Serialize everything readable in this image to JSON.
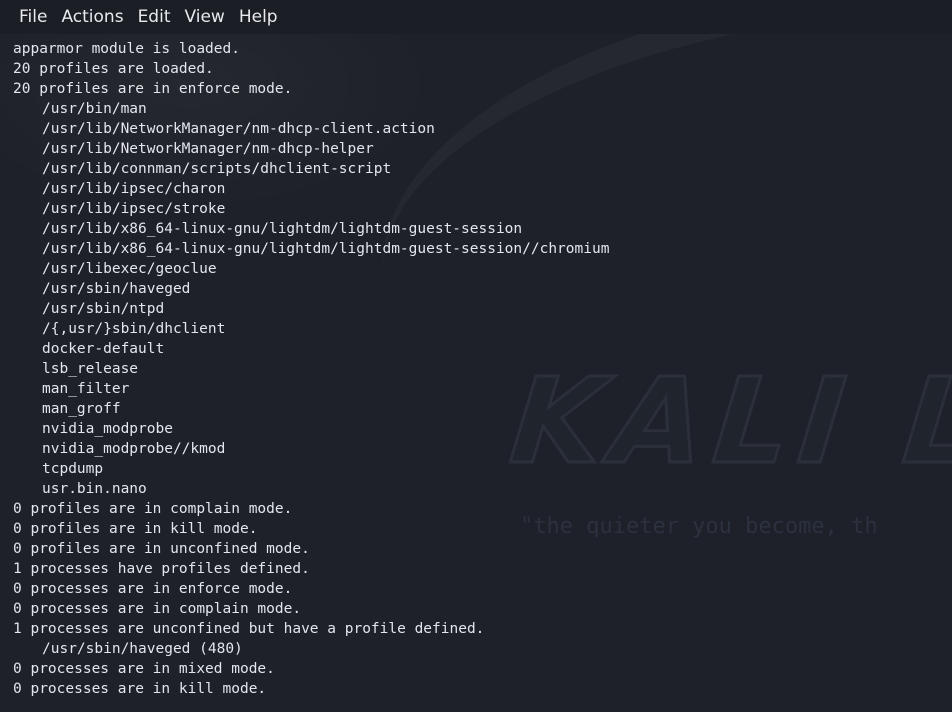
{
  "menubar": {
    "items": [
      {
        "key": "file",
        "label": "File"
      },
      {
        "key": "actions",
        "label": "Actions"
      },
      {
        "key": "edit",
        "label": "Edit"
      },
      {
        "key": "view",
        "label": "View"
      },
      {
        "key": "help",
        "label": "Help"
      }
    ]
  },
  "background": {
    "logo_text": "KALI L",
    "tagline": "\"the quieter you become, th"
  },
  "terminal": {
    "lines": [
      {
        "text": "apparmor module is loaded.",
        "indent": false
      },
      {
        "text": "20 profiles are loaded.",
        "indent": false
      },
      {
        "text": "20 profiles are in enforce mode.",
        "indent": false
      },
      {
        "text": "/usr/bin/man",
        "indent": true
      },
      {
        "text": "/usr/lib/NetworkManager/nm-dhcp-client.action",
        "indent": true
      },
      {
        "text": "/usr/lib/NetworkManager/nm-dhcp-helper",
        "indent": true
      },
      {
        "text": "/usr/lib/connman/scripts/dhclient-script",
        "indent": true
      },
      {
        "text": "/usr/lib/ipsec/charon",
        "indent": true
      },
      {
        "text": "/usr/lib/ipsec/stroke",
        "indent": true
      },
      {
        "text": "/usr/lib/x86_64-linux-gnu/lightdm/lightdm-guest-session",
        "indent": true
      },
      {
        "text": "/usr/lib/x86_64-linux-gnu/lightdm/lightdm-guest-session//chromium",
        "indent": true
      },
      {
        "text": "/usr/libexec/geoclue",
        "indent": true
      },
      {
        "text": "/usr/sbin/haveged",
        "indent": true
      },
      {
        "text": "/usr/sbin/ntpd",
        "indent": true
      },
      {
        "text": "/{,usr/}sbin/dhclient",
        "indent": true
      },
      {
        "text": "docker-default",
        "indent": true
      },
      {
        "text": "lsb_release",
        "indent": true
      },
      {
        "text": "man_filter",
        "indent": true
      },
      {
        "text": "man_groff",
        "indent": true
      },
      {
        "text": "nvidia_modprobe",
        "indent": true
      },
      {
        "text": "nvidia_modprobe//kmod",
        "indent": true
      },
      {
        "text": "tcpdump",
        "indent": true
      },
      {
        "text": "usr.bin.nano",
        "indent": true
      },
      {
        "text": "0 profiles are in complain mode.",
        "indent": false
      },
      {
        "text": "0 profiles are in kill mode.",
        "indent": false
      },
      {
        "text": "0 profiles are in unconfined mode.",
        "indent": false
      },
      {
        "text": "1 processes have profiles defined.",
        "indent": false
      },
      {
        "text": "0 processes are in enforce mode.",
        "indent": false
      },
      {
        "text": "0 processes are in complain mode.",
        "indent": false
      },
      {
        "text": "1 processes are unconfined but have a profile defined.",
        "indent": false
      },
      {
        "text": "/usr/sbin/haveged (480)",
        "indent": true
      },
      {
        "text": "0 processes are in mixed mode.",
        "indent": false
      },
      {
        "text": "0 processes are in kill mode.",
        "indent": false
      }
    ]
  }
}
